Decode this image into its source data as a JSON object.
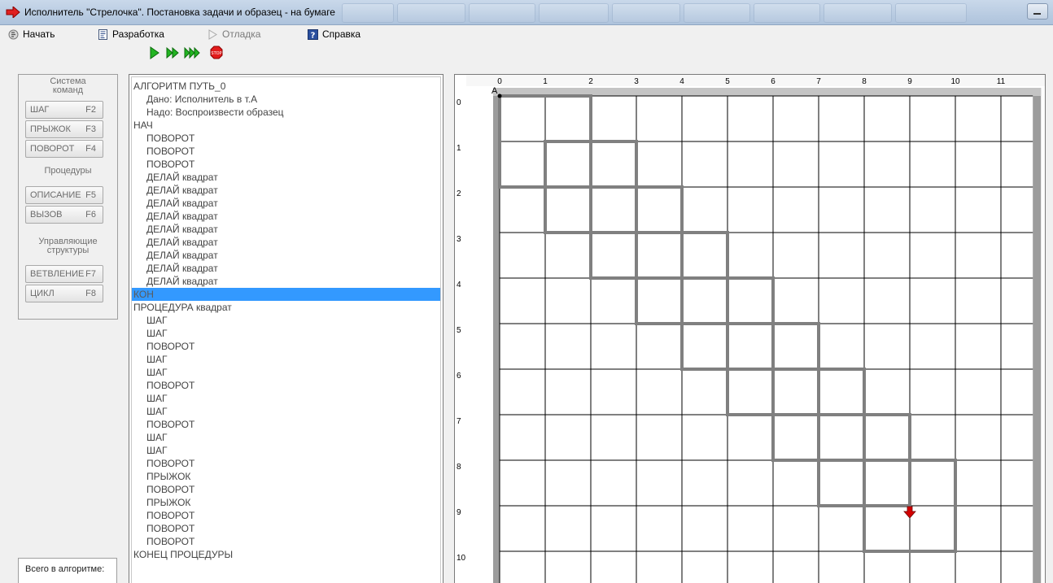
{
  "window": {
    "title": "Исполнитель \"Стрелочка\". Постановка задачи и образец - на бумаге"
  },
  "menu": [
    {
      "label": "Начать",
      "icon": "start-icon",
      "disabled": false
    },
    {
      "label": "Разработка",
      "icon": "document-icon",
      "disabled": false
    },
    {
      "label": "Отладка",
      "icon": "debug-triangle-icon",
      "disabled": true
    },
    {
      "label": "Справка",
      "icon": "help-icon",
      "disabled": false
    }
  ],
  "toolbar": {
    "icons": [
      "play-icon",
      "step-forward-icon",
      "fast-forward-icon",
      "stop-icon"
    ],
    "stop_text": "STOP"
  },
  "left_panel": {
    "commands_label": "Система команд",
    "cmd_step": {
      "name": "ШАГ",
      "key": "F2"
    },
    "cmd_jump": {
      "name": "ПРЫЖОК",
      "key": "F3"
    },
    "cmd_turn": {
      "name": "ПОВОРОТ",
      "key": "F4"
    },
    "procedures_label": "Процедуры",
    "cmd_describe": {
      "name": "ОПИСАНИЕ",
      "key": "F5"
    },
    "cmd_call": {
      "name": "ВЫЗОВ",
      "key": "F6"
    },
    "structures_label": "Управляющие структуры",
    "cmd_branch": {
      "name": "ВЕТВЛЕНИЕ",
      "key": "F7"
    },
    "cmd_loop": {
      "name": "ЦИКЛ",
      "key": "F8"
    }
  },
  "status": {
    "total_label": "Всего в алгоритме:"
  },
  "code": {
    "selected_index": 16,
    "lines": [
      {
        "text": "АЛГОРИТМ ПУТЬ_0",
        "indent": 0
      },
      {
        "text": "Дано: Исполнитель в т.А",
        "indent": 1
      },
      {
        "text": "Надо: Воспроизвести образец",
        "indent": 1
      },
      {
        "text": "НАЧ",
        "indent": 0
      },
      {
        "text": "ПОВОРОТ",
        "indent": 1
      },
      {
        "text": "ПОВОРОТ",
        "indent": 1
      },
      {
        "text": "ПОВОРОТ",
        "indent": 1
      },
      {
        "text": "ДЕЛАЙ квадрат",
        "indent": 1
      },
      {
        "text": "ДЕЛАЙ квадрат",
        "indent": 1
      },
      {
        "text": "ДЕЛАЙ квадрат",
        "indent": 1
      },
      {
        "text": "ДЕЛАЙ квадрат",
        "indent": 1
      },
      {
        "text": "ДЕЛАЙ квадрат",
        "indent": 1
      },
      {
        "text": "ДЕЛАЙ квадрат",
        "indent": 1
      },
      {
        "text": "ДЕЛАЙ квадрат",
        "indent": 1
      },
      {
        "text": "ДЕЛАЙ квадрат",
        "indent": 1
      },
      {
        "text": "ДЕЛАЙ квадрат",
        "indent": 1
      },
      {
        "text": "КОН",
        "indent": 0
      },
      {
        "text": "ПРОЦЕДУРА квадрат",
        "indent": 0
      },
      {
        "text": "ШАГ",
        "indent": 1
      },
      {
        "text": "ШАГ",
        "indent": 1
      },
      {
        "text": "ПОВОРОТ",
        "indent": 1
      },
      {
        "text": "ШАГ",
        "indent": 1
      },
      {
        "text": "ШАГ",
        "indent": 1
      },
      {
        "text": "ПОВОРОТ",
        "indent": 1
      },
      {
        "text": "ШАГ",
        "indent": 1
      },
      {
        "text": "ШАГ",
        "indent": 1
      },
      {
        "text": "ПОВОРОТ",
        "indent": 1
      },
      {
        "text": "ШАГ",
        "indent": 1
      },
      {
        "text": "ШАГ",
        "indent": 1
      },
      {
        "text": "ПОВОРОТ",
        "indent": 1
      },
      {
        "text": "ПРЫЖОК",
        "indent": 1
      },
      {
        "text": "ПОВОРОТ",
        "indent": 1
      },
      {
        "text": "ПРЫЖОК",
        "indent": 1
      },
      {
        "text": "ПОВОРОТ",
        "indent": 1
      },
      {
        "text": "ПОВОРОТ",
        "indent": 1
      },
      {
        "text": "ПОВОРОТ",
        "indent": 1
      },
      {
        "text": "КОНЕЦ ПРОЦЕДУРЫ",
        "indent": 0
      }
    ]
  },
  "field": {
    "col_labels": [
      "0",
      "1",
      "2",
      "3",
      "4",
      "5",
      "6",
      "7",
      "8",
      "9",
      "10",
      "11"
    ],
    "row_labels": [
      "0",
      "1",
      "2",
      "3",
      "4",
      "5",
      "6",
      "7",
      "8",
      "9",
      "10"
    ],
    "start_label": "A",
    "squares": [
      [
        0,
        0
      ],
      [
        1,
        1
      ],
      [
        2,
        2
      ],
      [
        3,
        3
      ],
      [
        4,
        4
      ],
      [
        5,
        5
      ],
      [
        6,
        6
      ],
      [
        7,
        7
      ],
      [
        8,
        8
      ]
    ],
    "square_size": 2,
    "arrow": {
      "x": 9,
      "y": 9,
      "direction": "down"
    },
    "path_color": "#808080",
    "arrow_color": "#d40000"
  }
}
